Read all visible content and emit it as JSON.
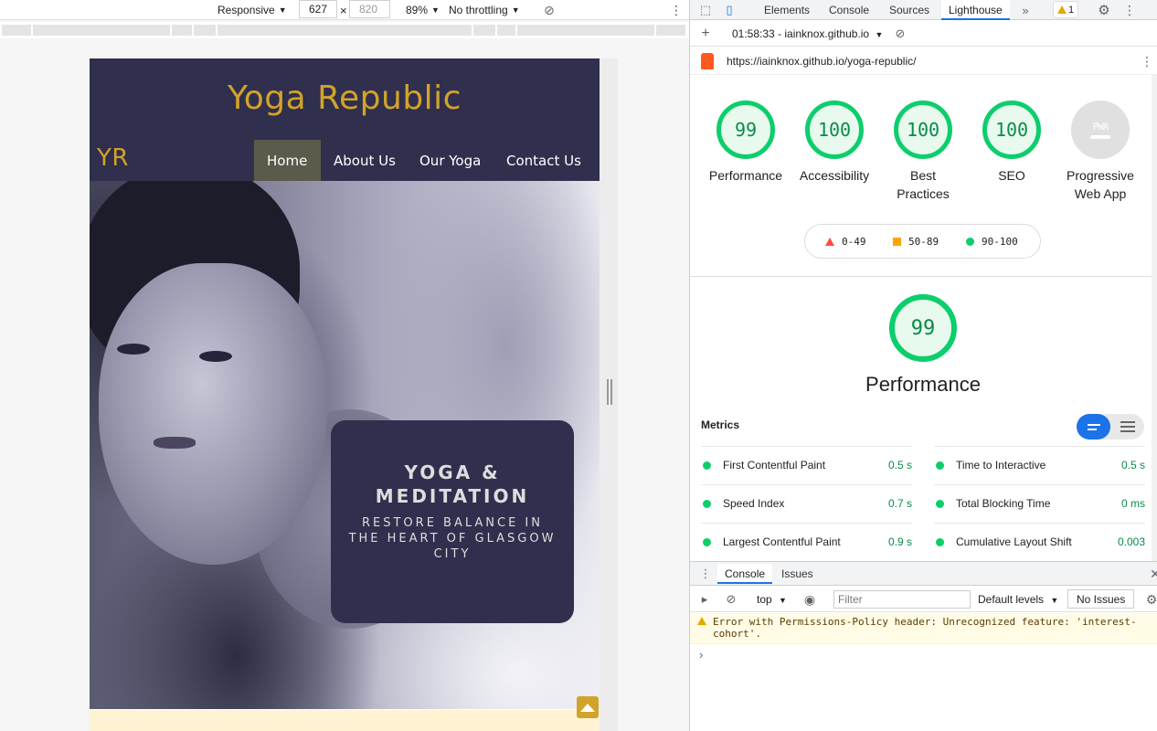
{
  "device_toolbar": {
    "dimensions_label": "Responsive",
    "width": "627",
    "height": "820",
    "zoom": "89%",
    "throttling": "No throttling"
  },
  "site": {
    "title": "Yoga Republic",
    "logo": "YR",
    "nav": [
      {
        "label": "Home",
        "active": true
      },
      {
        "label": "About Us",
        "active": false
      },
      {
        "label": "Our Yoga",
        "active": false
      },
      {
        "label": "Contact Us",
        "active": false
      }
    ],
    "hero": {
      "heading": "YOGA & MEDITATION",
      "subheading": "RESTORE BALANCE IN THE HEART OF GLASGOW CITY"
    },
    "colors": {
      "header_bg": "#302f4d",
      "accent": "#d2a32a"
    }
  },
  "devtools": {
    "tabs": [
      "Elements",
      "Console",
      "Sources",
      "Lighthouse"
    ],
    "active_tab": "Lighthouse",
    "warning_count": "1",
    "report_label": "01:58:33 - iainknox.github.io",
    "url": "https://iainknox.github.io/yoga-republic/"
  },
  "lighthouse": {
    "scores": [
      {
        "value": "99",
        "label": "Performance"
      },
      {
        "value": "100",
        "label": "Accessibility"
      },
      {
        "value": "100",
        "label": "Best Practices"
      },
      {
        "value": "100",
        "label": "SEO"
      },
      {
        "value": "",
        "label": "Progressive Web App",
        "badge": "PWA"
      }
    ],
    "legend": [
      "0-49",
      "50-89",
      "90-100"
    ],
    "performance_score": "99",
    "performance_label": "Performance",
    "metrics_title": "Metrics",
    "metrics": [
      {
        "name": "First Contentful Paint",
        "value": "0.5 s"
      },
      {
        "name": "Time to Interactive",
        "value": "0.5 s"
      },
      {
        "name": "Speed Index",
        "value": "0.7 s"
      },
      {
        "name": "Total Blocking Time",
        "value": "0 ms"
      },
      {
        "name": "Largest Contentful Paint",
        "value": "0.9 s"
      },
      {
        "name": "Cumulative Layout Shift",
        "value": "0.003"
      }
    ],
    "colors": {
      "pass": "#0cce6b",
      "average": "#ffa400",
      "fail": "#ff4e42"
    }
  },
  "console": {
    "tabs": [
      "Console",
      "Issues"
    ],
    "context": "top",
    "filter_placeholder": "Filter",
    "levels": "Default levels",
    "issues_button": "No Issues",
    "message": "Error with Permissions-Policy header: Unrecognized feature: 'interest-cohort'."
  }
}
